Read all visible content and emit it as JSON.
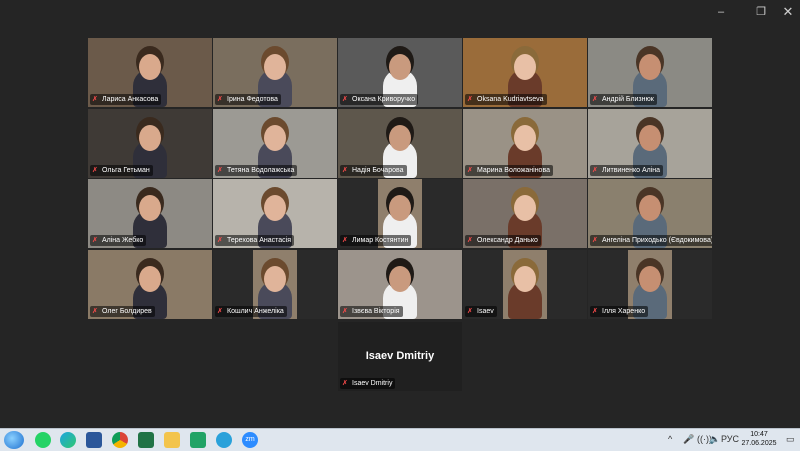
{
  "window": {
    "controls": {
      "minimize": "–",
      "maximize": "❐",
      "close": "✕"
    }
  },
  "participants": [
    {
      "name": "Лариса Анкасова",
      "bg": "#6b5a4a"
    },
    {
      "name": "Ірина Федотова",
      "bg": "#7a6e5e"
    },
    {
      "name": "Оксана Криворучко",
      "bg": "#5a5a5a"
    },
    {
      "name": "Oksana Kudriavtseva",
      "bg": "#9a6c3a"
    },
    {
      "name": "Андрій Близнюк",
      "bg": "#8b8a84"
    },
    {
      "name": "Ольга Гетьман",
      "bg": "#3f3a36"
    },
    {
      "name": "Тетяна Водолажська",
      "bg": "#9c9a94"
    },
    {
      "name": "Надія Бочарова",
      "bg": "#5e574c"
    },
    {
      "name": "Марина Воложанінова",
      "bg": "#9a9286"
    },
    {
      "name": "Литвиненко Аліна",
      "bg": "#a7a39a"
    },
    {
      "name": "Аліна Жебко",
      "bg": "#8d8a84"
    },
    {
      "name": "Терехова Анастасія",
      "bg": "#b7b3ab"
    },
    {
      "name": "Лимар Костянтин",
      "bg": "#2a2a2a"
    },
    {
      "name": "Олександр Данько",
      "bg": "#7a7068"
    },
    {
      "name": "Ангеліна Приходько (Євдокимова)",
      "bg": "#8a806e"
    },
    {
      "name": "Олег Болдирев",
      "bg": "#8a7a66"
    },
    {
      "name": "Кошлич Анжеліка",
      "bg": "#2a2a2a"
    },
    {
      "name": "Ізвєва Вікторія",
      "bg": "#9c948c"
    },
    {
      "name": "Isaev",
      "bg": "#2a2a2a"
    },
    {
      "name": "Ілля Харенко",
      "bg": "#2a2a2a"
    }
  ],
  "video_off": {
    "display_name": "Isaev Dmitriy",
    "label": "Isaev Dmitriy"
  },
  "taskbar": {
    "apps": [
      "whatsapp-icon",
      "edge-icon",
      "word-icon",
      "chrome-icon",
      "excel-icon",
      "explorer-icon",
      "teams-icon",
      "telegram-icon",
      "zoom-icon"
    ],
    "zoom_label": "zm",
    "language": "РУС",
    "time": "10:47",
    "date": "27.06.2025"
  },
  "colors": {
    "active_border": "#25c16b",
    "muted_mic": "#ff4c4c"
  }
}
